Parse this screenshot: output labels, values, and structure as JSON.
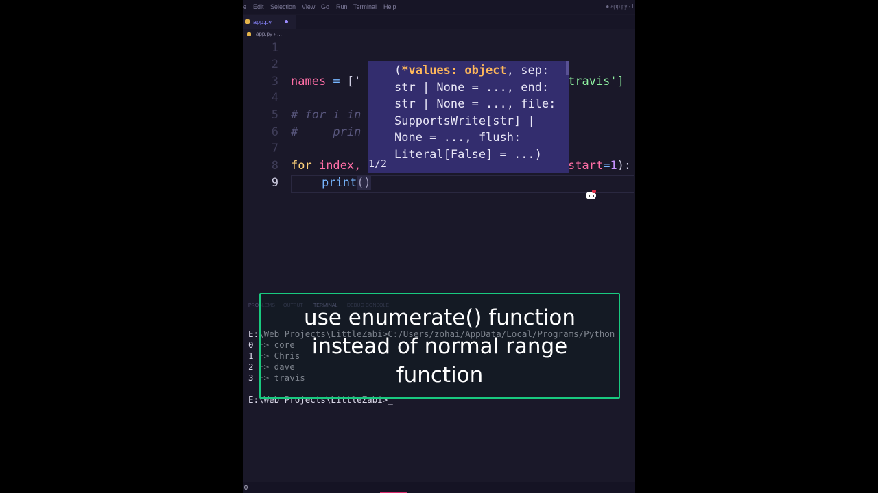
{
  "window": {
    "menu": [
      "e",
      "Edit",
      "Selection",
      "View",
      "Go",
      "Run",
      "Terminal",
      "Help"
    ],
    "title": "● app.py - L"
  },
  "tabs": [
    {
      "label": "app.py",
      "modified": true
    }
  ],
  "breadcrumb": "app.py › ...",
  "editor": {
    "line_numbers": [
      "1",
      "2",
      "3",
      "4",
      "5",
      "6",
      "7",
      "8",
      "9"
    ],
    "line3": {
      "var": "names",
      "eq": " = ",
      "open": "['",
      "close": "travis']"
    },
    "line5": "# for i in",
    "line6": "#     prin",
    "line8": {
      "for": "for",
      "var": " index,",
      "kw": "start",
      "eq": "=",
      "num": "1",
      "end": "):"
    },
    "line9": {
      "fn": "print",
      "parens": "()"
    }
  },
  "signature_hint": {
    "param_highlight": "*values: object",
    "text_open": "(",
    "text_rest": ", sep: str | None = ..., end: str | None = ..., file: SupportsWrite[str] | None = ..., flush: Literal[False] = ...)",
    "counter": "1/2"
  },
  "panel": {
    "tabs": [
      "PROBLEMS",
      "OUTPUT",
      "TERMINAL",
      "DEBUG CONSOLE"
    ],
    "active_tab": "TERMINAL",
    "terminal_lines": [
      "E:\\Web Projects\\LittleZabi>C:/Users/zohai/AppData/Local/Programs/Python",
      "0 => core",
      "1 => Chris",
      "2 => dave",
      "3 => travis",
      "",
      "E:\\Web Projects\\LittleZabi>_"
    ]
  },
  "status": {
    "left": "0"
  },
  "caption": {
    "lines": [
      "use enumerate() function",
      "instead of normal range",
      "function"
    ]
  },
  "colors": {
    "editor_bg": "#1a1829",
    "hint_bg": "#332d6e",
    "caption_border": "#19c97f",
    "keyword": "#ff6ea6",
    "string": "#8ef0a0",
    "function": "#77b6ff"
  }
}
